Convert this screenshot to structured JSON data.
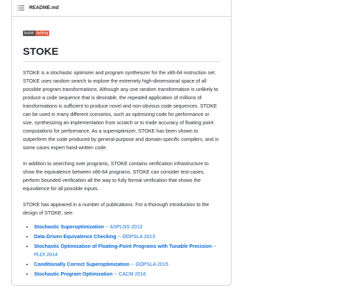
{
  "header": {
    "icon": "list-icon",
    "title": "README.md"
  },
  "badge": {
    "left": "build",
    "right": "failing",
    "left_color": "#555555",
    "right_color": "#e05d44"
  },
  "heading": "STOKE",
  "paragraphs": [
    "STOKE is a stochastic optimizer and program synthesizer for the x86-64 instruction set. STOKE uses random search to explore the extremely high-dimensional space of all possible program transformations. Although any one random transformation is unlikely to produce a code sequence that is desirable, the repeated application of millions of transformations is sufficient to produce novel and non-obvious code sequences. STOKE can be used in many different scenarios, such as optimizing code for performance or size, synthesizing an implementation from scratch or to trade accuracy of floating point computations for performance. As a superoptimizer, STOKE has been shown to outperform the code produced by general-purpose and domain-specific compilers, and in some cases expert hand-written code.",
    "In addition to searching over programs, STOKE contains verification infrastructure to show the equivalence between x86-64 programs. STOKE can consider test-cases, perform bounded verification all the way to fully formal verification that shows the equivalence for all possible inputs.",
    "STOKE has appeared in a number of publications. For a thorough introduction to the design of STOKE, see:"
  ],
  "publications": [
    {
      "title": "Stochastic Superoptimization",
      "venue": " -- ASPLOS 2013"
    },
    {
      "title": "Data-Driven Equivalence Checking",
      "venue": " -- OOPSLA 2013"
    },
    {
      "title": "Stochastic Optimization of Floating-Point Programs with Tunable Precision",
      "venue": " -- PLDI 2014"
    },
    {
      "title": "Conditionally Correct Superoptimization",
      "venue": " -- OOPSLA 2015"
    },
    {
      "title": "Stochastic Program Optimization",
      "venue": " -- CACM 2016"
    }
  ],
  "colors": {
    "link": "#0969da",
    "border": "#d0d7de",
    "text": "#24292f"
  }
}
